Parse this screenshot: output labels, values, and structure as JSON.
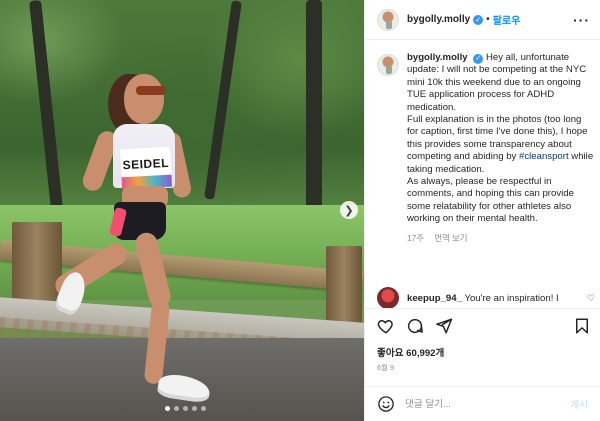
{
  "post": {
    "author": "bygolly.molly",
    "follow_label": "팔로우",
    "separator": "•",
    "more_label": "···",
    "image": {
      "bib_name": "SEIDEL",
      "carousel": {
        "count": 5,
        "active_index": 0
      }
    },
    "caption": {
      "author": "bygolly.molly",
      "paragraph_1": "Hey all, unfortunate update: I will not be competing at the NYC mini 10k this weekend due to an ongoing TUE application process for ADHD medication.",
      "paragraph_2_before": "Full explanation is in the photos (too long for caption, first time I've done this), I hope this provides some transparency about competing and abiding by ",
      "hashtag": "#cleansport",
      "paragraph_2_after": " while taking medication.",
      "paragraph_3": "As always, please be respectful in comments, and hoping this can provide some relatability for other athletes also working on their mental health.",
      "time_ago": "17주",
      "translate_label": "번역 보기"
    },
    "comments": [
      {
        "author": "keepup_94_",
        "text": "You're an inspiration! I"
      }
    ],
    "likes_text": "좋아요 60,992개",
    "date_text": "6월 9",
    "add_comment": {
      "placeholder": "댓글 달기...",
      "post_label": "게시"
    }
  },
  "icons": {
    "verified": "verified-badge-icon",
    "next": "chevron-right-icon",
    "like": "heart-icon",
    "comment": "comment-bubble-icon",
    "share": "paper-plane-icon",
    "save": "bookmark-icon",
    "emoji": "smiley-icon"
  },
  "colors": {
    "link": "#0095f6",
    "verified": "#3897f0",
    "muted": "#8e8e8e",
    "post_disabled": "#b2dffc"
  }
}
